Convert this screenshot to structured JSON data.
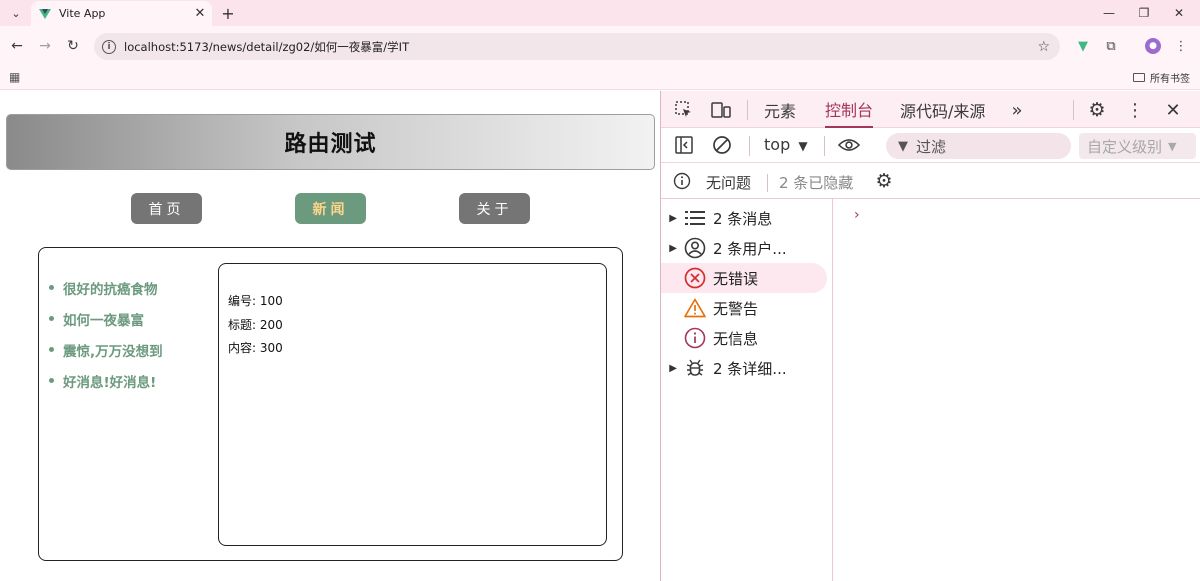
{
  "browser": {
    "tab_title": "Vite App",
    "url": "localhost:5173/news/detail/zg02/如何一夜暴富/学IT",
    "bookmarks_label": "所有书签"
  },
  "page": {
    "banner_title": "路由测试",
    "nav": [
      {
        "label": "首页",
        "active": false
      },
      {
        "label": "新闻",
        "active": true
      },
      {
        "label": "关于",
        "active": false
      }
    ],
    "news_list": [
      "很好的抗癌食物",
      "如何一夜暴富",
      "震惊,万万没想到",
      "好消息!好消息!"
    ],
    "detail": {
      "id_line": "编号: 100",
      "title_line": "标题: 200",
      "content_line": "内容: 300"
    }
  },
  "devtools": {
    "tabs": [
      "元素",
      "控制台",
      "源代码/来源"
    ],
    "active_tab": "控制台",
    "context": "top",
    "filter_placeholder": "过滤",
    "levels": "自定义级别",
    "issues": "无问题",
    "hidden_count": "2 条已隐藏",
    "sidebar": [
      {
        "label": "2 条消息",
        "icon": "list-icon",
        "expandable": true
      },
      {
        "label": "2 条用户...",
        "icon": "user-icon",
        "expandable": true
      },
      {
        "label": "无错误",
        "icon": "error-icon",
        "expandable": false
      },
      {
        "label": "无警告",
        "icon": "warning-icon",
        "expandable": false
      },
      {
        "label": "无信息",
        "icon": "info-icon",
        "expandable": false
      },
      {
        "label": "2 条详细...",
        "icon": "bug-icon",
        "expandable": true
      }
    ],
    "prompt": "›"
  },
  "colors": {
    "accent_green": "#6c9a7f",
    "active_text": "#fbd58a",
    "devtools_accent": "#a3365a"
  }
}
